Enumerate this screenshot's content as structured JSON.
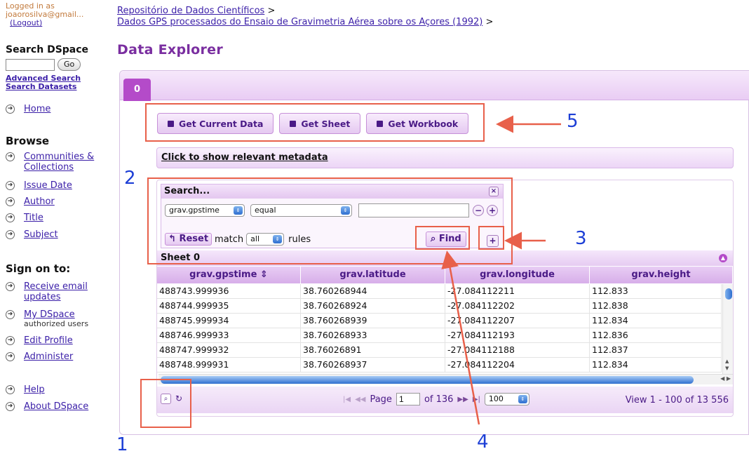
{
  "sidebar": {
    "login_prefix": "Logged in as",
    "login_email": "joaorosilva@gmail...",
    "logout": "(Logout)",
    "search_title": "Search DSpace",
    "go": "Go",
    "advanced_search": "Advanced Search",
    "search_datasets": "Search Datasets",
    "home": "Home",
    "browse_title": "Browse",
    "browse_items": [
      "Communities & Collections",
      "Issue Date",
      "Author",
      "Title",
      "Subject"
    ],
    "signon_title": "Sign on to:",
    "receive_email": "Receive email updates",
    "my_dspace": "My DSpace",
    "my_dspace_sub": "authorized users",
    "edit_profile": "Edit Profile",
    "administer": "Administer",
    "help": "Help",
    "about": "About DSpace"
  },
  "breadcrumb": {
    "level1": "Repositório de Dados Científicos",
    "level2": "Dados GPS processados do Ensaio de Gravimetria Aérea sobre os Açores (1992)",
    "separator": ">"
  },
  "page_title": "Data Explorer",
  "tabs": [
    "0"
  ],
  "buttons": {
    "get_current_data": "Get Current Data",
    "get_sheet": "Get Sheet",
    "get_workbook": "Get Workbook"
  },
  "metadata_link": "Click to show relevant metadata",
  "search": {
    "title": "Search...",
    "close": "×",
    "field": "grav.gpstime",
    "operator": "equal",
    "value": "",
    "minus": "−",
    "plus": "+",
    "reset": "Reset",
    "match_label": "match",
    "match_value": "all",
    "rules_label": "rules",
    "find": "Find"
  },
  "sheet": {
    "title": "Sheet 0",
    "columns": [
      "grav.gpstime ⇕",
      "grav.latitude",
      "grav.longitude",
      "grav.height"
    ],
    "rows": [
      [
        "488743.999936",
        "38.760268944",
        "-27.084112211",
        "112.833"
      ],
      [
        "488744.999935",
        "38.760268924",
        "-27.084112202",
        "112.838"
      ],
      [
        "488745.999934",
        "38.760268939",
        "-27.084112207",
        "112.834"
      ],
      [
        "488746.999933",
        "38.760268933",
        "-27.084112193",
        "112.836"
      ],
      [
        "488747.999932",
        "38.76026891",
        "-27.084112188",
        "112.837"
      ],
      [
        "488748.999931",
        "38.760268937",
        "-27.084112204",
        "112.834"
      ]
    ]
  },
  "pager": {
    "page_label": "Page",
    "page_value": "1",
    "of_label": "of 136",
    "rows_per_page": "100",
    "view_info": "View 1 - 100 of 13 556"
  },
  "annotations": [
    "1",
    "2",
    "3",
    "4",
    "5"
  ],
  "colors": {
    "accent": "#b44bc9",
    "title": "#7a2ea0",
    "annotation_box": "#e8604a",
    "annotation_number": "#1d3fd6"
  }
}
